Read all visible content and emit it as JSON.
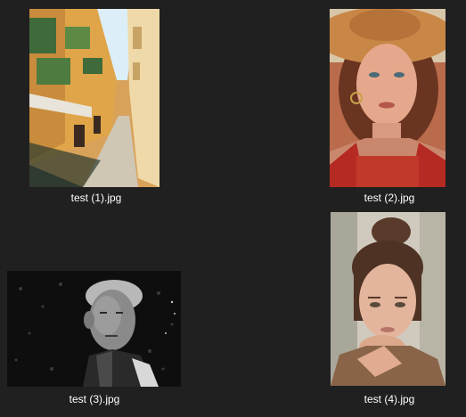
{
  "files": [
    {
      "name": "test (1).jpg",
      "thumbnail": "street-photo"
    },
    {
      "name": "test (2).jpg",
      "thumbnail": "portrait-hat-photo"
    },
    {
      "name": "test (3).jpg",
      "thumbnail": "old-man-bw-photo"
    },
    {
      "name": "test (4).jpg",
      "thumbnail": "portrait-bun-photo"
    }
  ],
  "colors": {
    "background": "#202020",
    "caption_text": "#ffffff"
  }
}
